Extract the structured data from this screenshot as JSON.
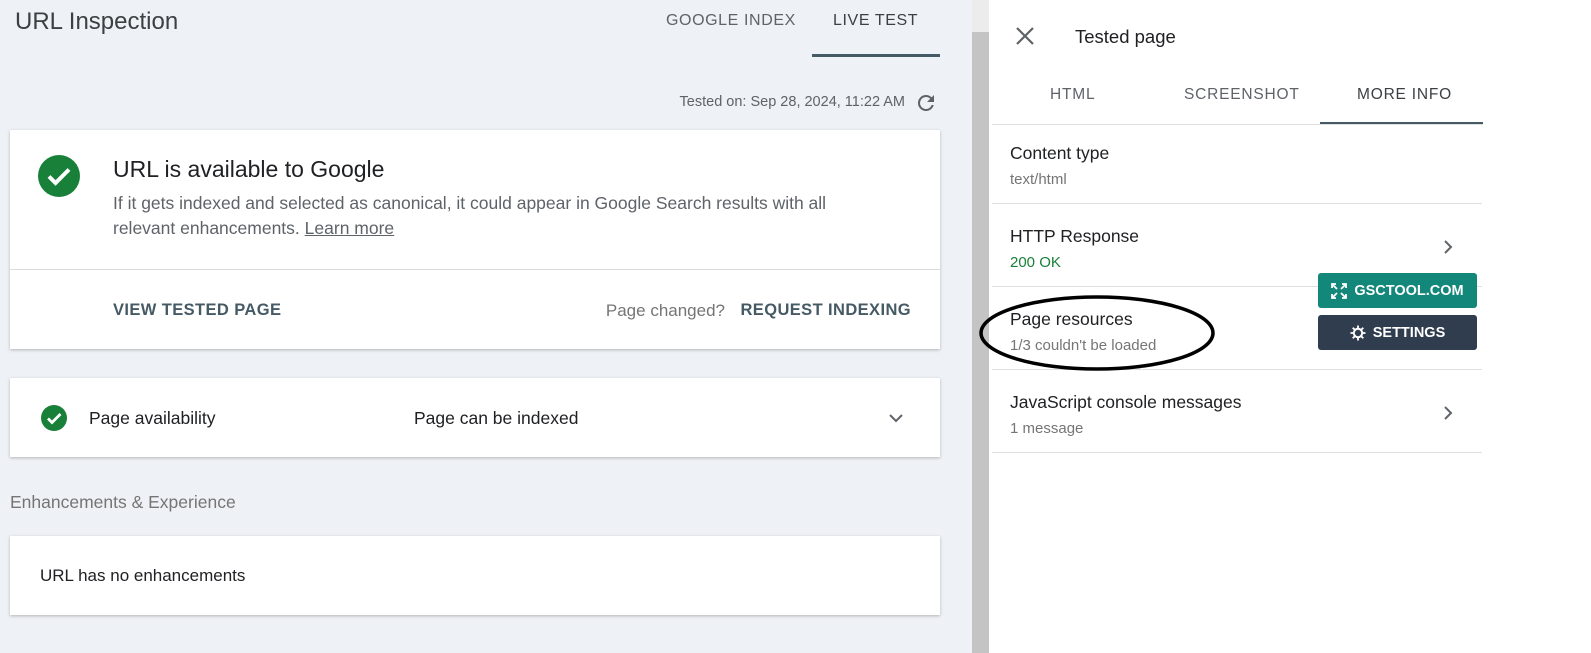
{
  "header": {
    "title": "URL Inspection",
    "tabs": [
      "GOOGLE INDEX",
      "LIVE TEST"
    ],
    "active_tab": "LIVE TEST",
    "tested_on": "Tested on: Sep 28, 2024, 11:22 AM"
  },
  "status_card": {
    "title": "URL is available to Google",
    "description": "If it gets indexed and selected as canonical, it could appear in Google Search results with all relevant enhancements.",
    "learn_more": "Learn more",
    "view_tested_page": "VIEW TESTED PAGE",
    "page_changed": "Page changed?",
    "request_indexing": "REQUEST INDEXING"
  },
  "availability": {
    "label": "Page availability",
    "value": "Page can be indexed"
  },
  "enhancements": {
    "section_label": "Enhancements & Experience",
    "message": "URL has no enhancements"
  },
  "panel": {
    "title": "Tested page",
    "tabs": [
      "HTML",
      "SCREENSHOT",
      "MORE INFO"
    ],
    "active_tab": "MORE INFO",
    "rows": [
      {
        "title": "Content type",
        "sub": "text/html"
      },
      {
        "title": "HTTP Response",
        "sub": "200 OK"
      },
      {
        "title": "Page resources",
        "sub": "1/3 couldn't be loaded"
      },
      {
        "title": "JavaScript console messages",
        "sub": "1 message"
      }
    ]
  },
  "extension": {
    "gsctool_label": "GSCTOOL.COM",
    "settings_label": "SETTINGS"
  },
  "colors": {
    "success_green": "#188038",
    "accent_slate": "#455a64",
    "gsc_teal": "#13877a",
    "settings_dark": "#2f3d4e"
  }
}
